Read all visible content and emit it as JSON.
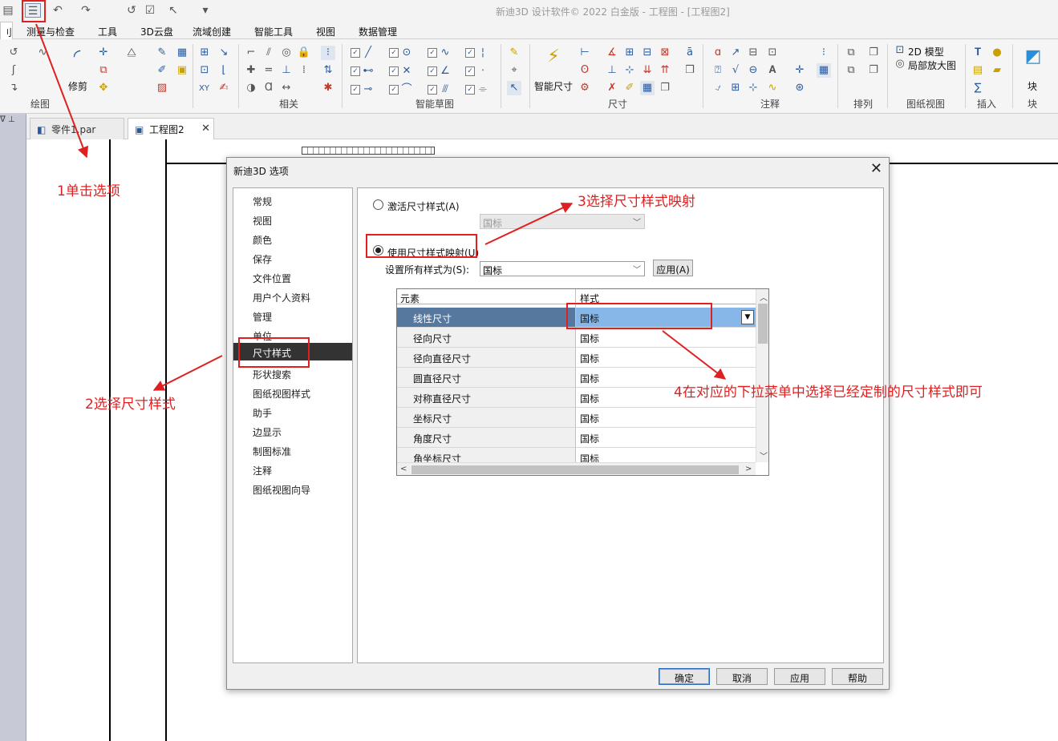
{
  "app": {
    "title": "新迪3D 设计软件© 2022 白金版 - 工程图 - [工程图2]"
  },
  "ribbon": {
    "tabs": [
      {
        "label": "测量与检查"
      },
      {
        "label": "工具"
      },
      {
        "label": "3D云盘"
      },
      {
        "label": "流域创建"
      },
      {
        "label": "智能工具"
      },
      {
        "label": "视图"
      },
      {
        "label": "数据管理"
      }
    ],
    "first_tab_fragment": "刂",
    "groups": {
      "draw": "绘图",
      "relate": "相关",
      "smart_sketch": "智能草图",
      "dimension": "尺寸",
      "annotation": "注释",
      "arrange": "排列",
      "drawing_view": "图纸视图",
      "insert": "插入",
      "block": "块"
    },
    "trim_label": "修剪",
    "smart_dim_label": "智能尺寸",
    "xy_label": "XY",
    "model_2d_label": "2D 模型",
    "detail_view_label": "局部放大图",
    "block_top": "块"
  },
  "doc_tabs": [
    {
      "label": "零件1.par",
      "icon": "part-icon"
    },
    {
      "label": "工程图2",
      "icon": "drawing-icon",
      "active": true
    }
  ],
  "dialog": {
    "title": "新迪3D 选项",
    "categories": [
      "常规",
      "视图",
      "颜色",
      "保存",
      "文件位置",
      "用户个人资料",
      "管理",
      "单位",
      "尺寸样式",
      "形状搜索",
      "图纸视图样式",
      "助手",
      "边显示",
      "制图标准",
      "注释",
      "图纸视图向导"
    ],
    "selected_category": "尺寸样式",
    "activate_radio_label": "激活尺寸样式(A)",
    "activate_combo_value": "国标",
    "mapping_radio_label": "使用尺寸样式映射(U)",
    "set_all_label": "设置所有样式为(S):",
    "set_all_value": "国标",
    "apply_small_label": "应用(A)",
    "grid": {
      "headers": [
        "元素",
        "样式"
      ],
      "rows": [
        {
          "element": "线性尺寸",
          "style": "国标"
        },
        {
          "element": "径向尺寸",
          "style": "国标"
        },
        {
          "element": "径向直径尺寸",
          "style": "国标"
        },
        {
          "element": "圆直径尺寸",
          "style": "国标"
        },
        {
          "element": "对称直径尺寸",
          "style": "国标"
        },
        {
          "element": "坐标尺寸",
          "style": "国标"
        },
        {
          "element": "角度尺寸",
          "style": "国标"
        },
        {
          "element": "角坐标尺寸",
          "style": "国标"
        }
      ]
    },
    "buttons": {
      "ok": "确定",
      "cancel": "取消",
      "apply": "应用",
      "help": "帮助"
    }
  },
  "annotations": {
    "step1": "1单击选项",
    "step2": "2选择尺寸样式",
    "step3": "3选择尺寸样式映射",
    "step4": "4在对应的下拉菜单中选择已经定制的尺寸样式即可",
    "color": "#e02020"
  },
  "colors": {
    "selected_row": "#56789e",
    "selected_cell": "#86b7e8",
    "selected_category": "#333333"
  }
}
